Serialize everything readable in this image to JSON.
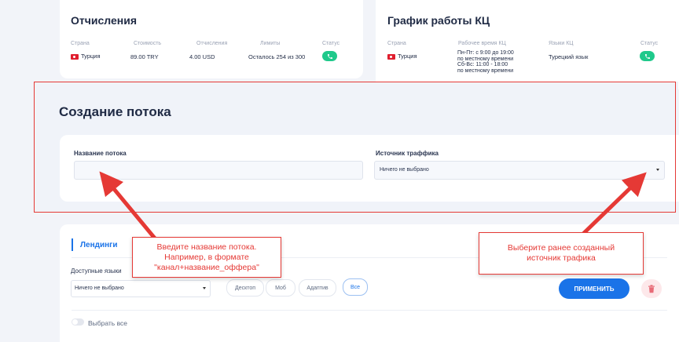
{
  "deductions": {
    "title": "Отчисления",
    "headers": [
      "Страна",
      "Стоимость",
      "Отчисления",
      "Лимиты",
      "Статус"
    ],
    "country": "Турция",
    "cost": "89.00 TRY",
    "deduction": "4.00 USD",
    "limits": "Осталось 254 из 300"
  },
  "schedule": {
    "title": "График работы КЦ",
    "headers": [
      "Страна",
      "Рабочее время КЦ",
      "Языки КЦ",
      "Статус"
    ],
    "country": "Турция",
    "time_lines": [
      "Пн-Пт: с 9:00 до 19:00",
      "по местному времени",
      "Сб-Вс: 11:00 - 18:00",
      "по местному времени"
    ],
    "language": "Турецкий язык"
  },
  "stream": {
    "title": "Создание потока",
    "name_label": "Название потока",
    "name_value": "",
    "source_label": "Источник траффика",
    "source_value": "Ничего не выбрано"
  },
  "landings": {
    "tab": "Лендинги",
    "langs_label": "Доступные языки",
    "langs_value": "Ничего не выбрано",
    "filters": [
      "Десктоп",
      "Моб",
      "Адаптив",
      "Все"
    ],
    "apply": "ПРИМЕНИТЬ",
    "select_all": "Выбрать все"
  },
  "callouts": {
    "left": "Введите название потока. Например, в формате \"канал+название_оффера\"",
    "right": "Выберите ранее созданный источник трафика"
  },
  "colors": {
    "accent": "#1a73e8",
    "status": "#1fc98b",
    "annotation": "#e53935"
  },
  "icons": [
    "phone-icon",
    "trash-icon",
    "chevron-down-icon",
    "turkey-flag-icon"
  ]
}
